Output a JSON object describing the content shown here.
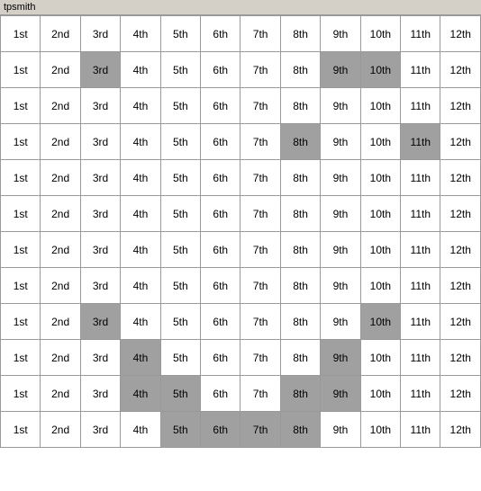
{
  "title": "tpsmith",
  "columns": [
    "1st",
    "2nd",
    "3rd",
    "4th",
    "5th",
    "6th",
    "7th",
    "8th",
    "9th",
    "10th",
    "11th",
    "12th"
  ],
  "rows": [
    {
      "cells": [
        {
          "text": "1st",
          "bg": "white"
        },
        {
          "text": "2nd",
          "bg": "white"
        },
        {
          "text": "3rd",
          "bg": "white"
        },
        {
          "text": "4th",
          "bg": "white"
        },
        {
          "text": "5th",
          "bg": "white"
        },
        {
          "text": "6th",
          "bg": "white"
        },
        {
          "text": "7th",
          "bg": "white"
        },
        {
          "text": "8th",
          "bg": "white"
        },
        {
          "text": "9th",
          "bg": "white"
        },
        {
          "text": "10th",
          "bg": "white"
        },
        {
          "text": "11th",
          "bg": "white"
        },
        {
          "text": "12th",
          "bg": "white"
        }
      ]
    },
    {
      "cells": [
        {
          "text": "1st",
          "bg": "white"
        },
        {
          "text": "2nd",
          "bg": "white"
        },
        {
          "text": "3rd",
          "bg": "gray"
        },
        {
          "text": "4th",
          "bg": "white"
        },
        {
          "text": "5th",
          "bg": "white"
        },
        {
          "text": "6th",
          "bg": "white"
        },
        {
          "text": "7th",
          "bg": "white"
        },
        {
          "text": "8th",
          "bg": "white"
        },
        {
          "text": "9th",
          "bg": "gray"
        },
        {
          "text": "10th",
          "bg": "gray"
        },
        {
          "text": "11th",
          "bg": "white"
        },
        {
          "text": "12th",
          "bg": "white"
        }
      ]
    },
    {
      "cells": [
        {
          "text": "1st",
          "bg": "white"
        },
        {
          "text": "2nd",
          "bg": "white"
        },
        {
          "text": "3rd",
          "bg": "white"
        },
        {
          "text": "4th",
          "bg": "white"
        },
        {
          "text": "5th",
          "bg": "white"
        },
        {
          "text": "6th",
          "bg": "white"
        },
        {
          "text": "7th",
          "bg": "white"
        },
        {
          "text": "8th",
          "bg": "white"
        },
        {
          "text": "9th",
          "bg": "white"
        },
        {
          "text": "10th",
          "bg": "white"
        },
        {
          "text": "11th",
          "bg": "white"
        },
        {
          "text": "12th",
          "bg": "white"
        }
      ]
    },
    {
      "cells": [
        {
          "text": "1st",
          "bg": "white"
        },
        {
          "text": "2nd",
          "bg": "white"
        },
        {
          "text": "3rd",
          "bg": "white"
        },
        {
          "text": "4th",
          "bg": "white"
        },
        {
          "text": "5th",
          "bg": "white"
        },
        {
          "text": "6th",
          "bg": "white"
        },
        {
          "text": "7th",
          "bg": "white"
        },
        {
          "text": "8th",
          "bg": "gray"
        },
        {
          "text": "9th",
          "bg": "white"
        },
        {
          "text": "10th",
          "bg": "white"
        },
        {
          "text": "11th",
          "bg": "gray"
        },
        {
          "text": "12th",
          "bg": "white"
        }
      ]
    },
    {
      "cells": [
        {
          "text": "1st",
          "bg": "white"
        },
        {
          "text": "2nd",
          "bg": "white"
        },
        {
          "text": "3rd",
          "bg": "white"
        },
        {
          "text": "4th",
          "bg": "white"
        },
        {
          "text": "5th",
          "bg": "white"
        },
        {
          "text": "6th",
          "bg": "white"
        },
        {
          "text": "7th",
          "bg": "white"
        },
        {
          "text": "8th",
          "bg": "white"
        },
        {
          "text": "9th",
          "bg": "white"
        },
        {
          "text": "10th",
          "bg": "white"
        },
        {
          "text": "11th",
          "bg": "white"
        },
        {
          "text": "12th",
          "bg": "white"
        }
      ]
    },
    {
      "cells": [
        {
          "text": "1st",
          "bg": "white"
        },
        {
          "text": "2nd",
          "bg": "white"
        },
        {
          "text": "3rd",
          "bg": "white"
        },
        {
          "text": "4th",
          "bg": "white"
        },
        {
          "text": "5th",
          "bg": "white"
        },
        {
          "text": "6th",
          "bg": "white"
        },
        {
          "text": "7th",
          "bg": "white"
        },
        {
          "text": "8th",
          "bg": "white"
        },
        {
          "text": "9th",
          "bg": "white"
        },
        {
          "text": "10th",
          "bg": "white"
        },
        {
          "text": "11th",
          "bg": "white"
        },
        {
          "text": "12th",
          "bg": "white"
        }
      ]
    },
    {
      "cells": [
        {
          "text": "1st",
          "bg": "white"
        },
        {
          "text": "2nd",
          "bg": "white"
        },
        {
          "text": "3rd",
          "bg": "white"
        },
        {
          "text": "4th",
          "bg": "white"
        },
        {
          "text": "5th",
          "bg": "white"
        },
        {
          "text": "6th",
          "bg": "white"
        },
        {
          "text": "7th",
          "bg": "white"
        },
        {
          "text": "8th",
          "bg": "white"
        },
        {
          "text": "9th",
          "bg": "white"
        },
        {
          "text": "10th",
          "bg": "white"
        },
        {
          "text": "11th",
          "bg": "white"
        },
        {
          "text": "12th",
          "bg": "white"
        }
      ]
    },
    {
      "cells": [
        {
          "text": "1st",
          "bg": "white"
        },
        {
          "text": "2nd",
          "bg": "white"
        },
        {
          "text": "3rd",
          "bg": "white"
        },
        {
          "text": "4th",
          "bg": "white"
        },
        {
          "text": "5th",
          "bg": "white"
        },
        {
          "text": "6th",
          "bg": "white"
        },
        {
          "text": "7th",
          "bg": "white"
        },
        {
          "text": "8th",
          "bg": "white"
        },
        {
          "text": "9th",
          "bg": "white"
        },
        {
          "text": "10th",
          "bg": "white"
        },
        {
          "text": "11th",
          "bg": "white"
        },
        {
          "text": "12th",
          "bg": "white"
        }
      ]
    },
    {
      "cells": [
        {
          "text": "1st",
          "bg": "white"
        },
        {
          "text": "2nd",
          "bg": "white"
        },
        {
          "text": "3rd",
          "bg": "gray"
        },
        {
          "text": "4th",
          "bg": "white"
        },
        {
          "text": "5th",
          "bg": "white"
        },
        {
          "text": "6th",
          "bg": "white"
        },
        {
          "text": "7th",
          "bg": "white"
        },
        {
          "text": "8th",
          "bg": "white"
        },
        {
          "text": "9th",
          "bg": "white"
        },
        {
          "text": "10th",
          "bg": "gray"
        },
        {
          "text": "11th",
          "bg": "white"
        },
        {
          "text": "12th",
          "bg": "white"
        }
      ]
    },
    {
      "cells": [
        {
          "text": "1st",
          "bg": "white"
        },
        {
          "text": "2nd",
          "bg": "white"
        },
        {
          "text": "3rd",
          "bg": "white"
        },
        {
          "text": "4th",
          "bg": "gray"
        },
        {
          "text": "5th",
          "bg": "white"
        },
        {
          "text": "6th",
          "bg": "white"
        },
        {
          "text": "7th",
          "bg": "white"
        },
        {
          "text": "8th",
          "bg": "white"
        },
        {
          "text": "9th",
          "bg": "gray"
        },
        {
          "text": "10th",
          "bg": "white"
        },
        {
          "text": "11th",
          "bg": "white"
        },
        {
          "text": "12th",
          "bg": "white"
        }
      ]
    },
    {
      "cells": [
        {
          "text": "1st",
          "bg": "white"
        },
        {
          "text": "2nd",
          "bg": "white"
        },
        {
          "text": "3rd",
          "bg": "white"
        },
        {
          "text": "4th",
          "bg": "gray"
        },
        {
          "text": "5th",
          "bg": "gray"
        },
        {
          "text": "6th",
          "bg": "white"
        },
        {
          "text": "7th",
          "bg": "white"
        },
        {
          "text": "8th",
          "bg": "gray"
        },
        {
          "text": "9th",
          "bg": "gray"
        },
        {
          "text": "10th",
          "bg": "white"
        },
        {
          "text": "11th",
          "bg": "white"
        },
        {
          "text": "12th",
          "bg": "white"
        }
      ]
    },
    {
      "cells": [
        {
          "text": "1st",
          "bg": "white"
        },
        {
          "text": "2nd",
          "bg": "white"
        },
        {
          "text": "3rd",
          "bg": "white"
        },
        {
          "text": "4th",
          "bg": "white"
        },
        {
          "text": "5th",
          "bg": "gray"
        },
        {
          "text": "6th",
          "bg": "gray"
        },
        {
          "text": "7th",
          "bg": "gray"
        },
        {
          "text": "8th",
          "bg": "gray"
        },
        {
          "text": "9th",
          "bg": "white"
        },
        {
          "text": "10th",
          "bg": "white"
        },
        {
          "text": "11th",
          "bg": "white"
        },
        {
          "text": "12th",
          "bg": "white"
        }
      ]
    }
  ]
}
